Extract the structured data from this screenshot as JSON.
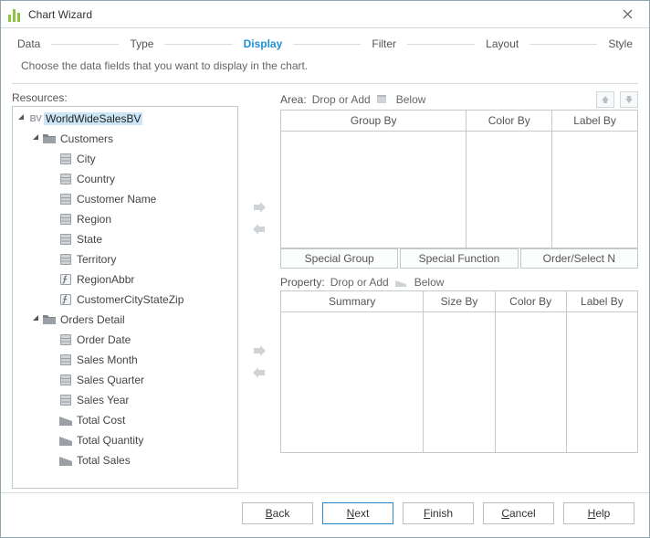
{
  "window": {
    "title": "Chart Wizard"
  },
  "steps": [
    {
      "label": "Data",
      "active": false
    },
    {
      "label": "Type",
      "active": false
    },
    {
      "label": "Display",
      "active": true
    },
    {
      "label": "Filter",
      "active": false
    },
    {
      "label": "Layout",
      "active": false
    },
    {
      "label": "Style",
      "active": false
    }
  ],
  "instruction": "Choose the data fields that you want to display in the chart.",
  "resources": {
    "label": "Resources:",
    "root": {
      "label": "WorldWideSalesBV",
      "selected": true,
      "expanded": true
    },
    "groups": [
      {
        "label": "Customers",
        "expanded": true,
        "fields": [
          {
            "label": "City",
            "icon": "db"
          },
          {
            "label": "Country",
            "icon": "db"
          },
          {
            "label": "Customer Name",
            "icon": "db"
          },
          {
            "label": "Region",
            "icon": "db"
          },
          {
            "label": "State",
            "icon": "db"
          },
          {
            "label": "Territory",
            "icon": "db"
          },
          {
            "label": "RegionAbbr",
            "icon": "fx"
          },
          {
            "label": "CustomerCityStateZip",
            "icon": "fx"
          }
        ]
      },
      {
        "label": "Orders Detail",
        "expanded": true,
        "fields": [
          {
            "label": "Order Date",
            "icon": "db"
          },
          {
            "label": "Sales Month",
            "icon": "db"
          },
          {
            "label": "Sales Quarter",
            "icon": "db"
          },
          {
            "label": "Sales Year",
            "icon": "db"
          },
          {
            "label": "Total Cost",
            "icon": "num"
          },
          {
            "label": "Total Quantity",
            "icon": "num"
          },
          {
            "label": "Total Sales",
            "icon": "num"
          }
        ]
      }
    ]
  },
  "area": {
    "title_prefix": "Area:",
    "title_text": "Drop or Add",
    "title_suffix": "Below",
    "headers": [
      "Group By",
      "Color By",
      "Label By"
    ],
    "buttons": [
      "Special Group",
      "Special Function",
      "Order/Select N"
    ]
  },
  "property": {
    "title_prefix": "Property:",
    "title_text": "Drop or Add",
    "title_suffix": "Below",
    "headers": [
      "Summary",
      "Size By",
      "Color By",
      "Label By"
    ]
  },
  "footer": {
    "back": "Back",
    "next": "Next",
    "finish": "Finish",
    "cancel": "Cancel",
    "help": "Help"
  },
  "icon_names": {
    "db": "database-field-icon",
    "fx": "formula-field-icon",
    "num": "numeric-field-icon",
    "folder": "folder-icon",
    "bv": "business-view-icon"
  }
}
